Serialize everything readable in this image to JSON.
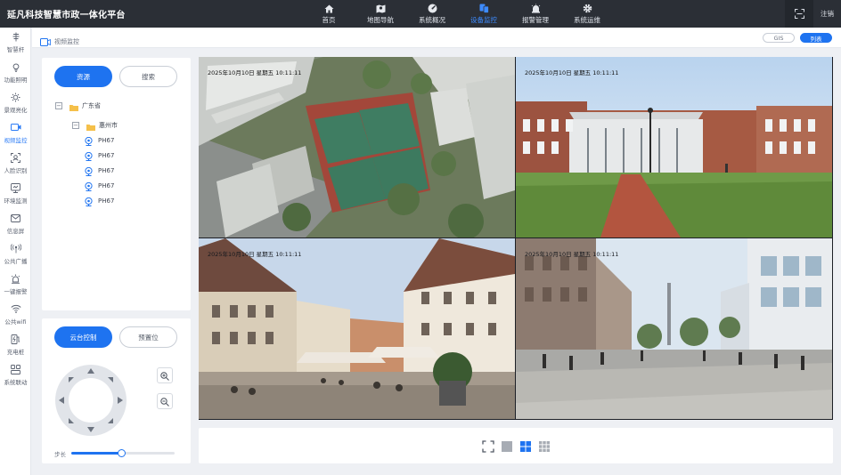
{
  "app": {
    "title": "延凡科技智慧市政一体化平台"
  },
  "nav": {
    "items": [
      {
        "label": "首页",
        "icon": "home-icon",
        "active": false
      },
      {
        "label": "地图导航",
        "icon": "map-icon",
        "active": false
      },
      {
        "label": "系统概况",
        "icon": "dashboard-icon",
        "active": false
      },
      {
        "label": "设备监控",
        "icon": "device-monitor-icon",
        "active": true
      },
      {
        "label": "报警管理",
        "icon": "alarm-icon",
        "active": false
      },
      {
        "label": "系统运维",
        "icon": "gear-icon",
        "active": false
      }
    ],
    "fullscreen_icon": "fullscreen-icon",
    "logout": "注销"
  },
  "sidebar": {
    "items": [
      {
        "label": "智慧杆",
        "icon": "smart-pole-icon",
        "active": false
      },
      {
        "label": "功能照明",
        "icon": "lamp-icon",
        "active": false
      },
      {
        "label": "景观亮化",
        "icon": "sun-icon",
        "active": false
      },
      {
        "label": "视频监控",
        "icon": "video-camera-icon",
        "active": true
      },
      {
        "label": "人脸识别",
        "icon": "face-scan-icon",
        "active": false
      },
      {
        "label": "环境监测",
        "icon": "environment-icon",
        "active": false
      },
      {
        "label": "信息屏",
        "icon": "mail-icon",
        "active": false
      },
      {
        "label": "公共广播",
        "icon": "broadcast-icon",
        "active": false
      },
      {
        "label": "一键报警",
        "icon": "siren-icon",
        "active": false
      },
      {
        "label": "公共wifi",
        "icon": "wifi-icon",
        "active": false
      },
      {
        "label": "充电桩",
        "icon": "charger-icon",
        "active": false
      },
      {
        "label": "系统联动",
        "icon": "link-icon",
        "active": false
      }
    ]
  },
  "breadcrumb": {
    "label": "视频监控",
    "icon": "video-camera-icon"
  },
  "view_toggle": {
    "gis": "GIS",
    "list": "列表",
    "active": "list"
  },
  "resource_panel": {
    "tabs": {
      "resource": "资源",
      "search": "搜索",
      "active": "resource"
    },
    "tree": {
      "province": "广东省",
      "city": "惠州市",
      "cameras": [
        "PH67",
        "PH67",
        "PH67",
        "PH67",
        "PH67"
      ]
    }
  },
  "ptz_panel": {
    "tabs": {
      "ptz": "云台控制",
      "preset": "预置位",
      "active": "ptz"
    },
    "step_label": "步长",
    "step_value": 0.48
  },
  "videos": [
    {
      "timestamp": "2025年10月10日 星期五 10:11:11",
      "scene": "aerial-campus"
    },
    {
      "timestamp": "2025年10月10日 星期五 10:11:11",
      "scene": "brick-building-lawn"
    },
    {
      "timestamp": "2025年10月10日 星期五 10:11:11",
      "scene": "old-town-square"
    },
    {
      "timestamp": "2025年10月10日 星期五 10:11:11",
      "scene": "shopping-street"
    }
  ],
  "layout_bar": {
    "options": [
      {
        "name": "fullscreen-layout-icon",
        "active": false
      },
      {
        "name": "single-layout-icon",
        "active": false
      },
      {
        "name": "quad-layout-icon",
        "active": true
      },
      {
        "name": "nine-layout-icon",
        "active": false
      }
    ]
  },
  "colors": {
    "accent": "#1e73f0",
    "topbar": "#2b2f36",
    "nav_active": "#3d8bff"
  }
}
